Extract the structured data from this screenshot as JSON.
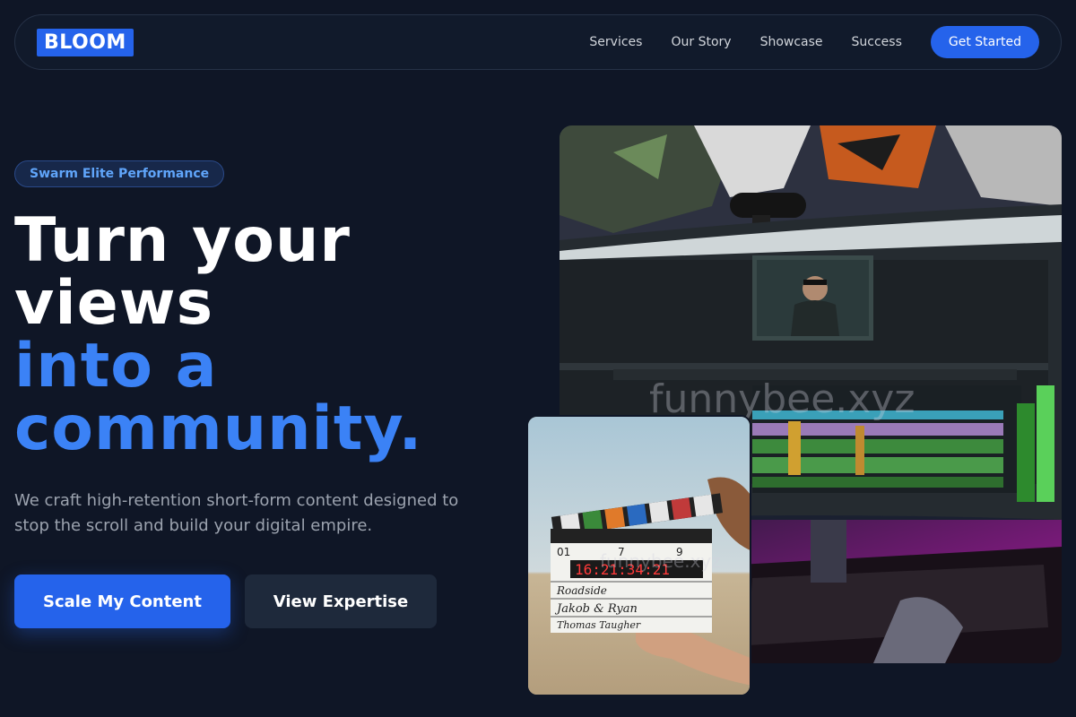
{
  "nav": {
    "logo": "BLOOM",
    "links": [
      "Services",
      "Our Story",
      "Showcase",
      "Success"
    ],
    "cta": "Get Started"
  },
  "hero": {
    "badge": "Swarm Elite Performance",
    "headline": {
      "line1": "Turn your",
      "line2": "views",
      "line3": "into a",
      "line4": "community."
    },
    "subtitle": "We craft high-retention short-form content designed to stop the scroll and build your digital empire.",
    "primary_button": "Scale My Content",
    "secondary_button": "View Expertise"
  },
  "images": {
    "main_watermark": "funnybee.xyz",
    "small_watermark": "funnybee.xyz",
    "clapper": {
      "roll": "01",
      "scene": "7",
      "take": "9",
      "timecode": "16:21:34:21",
      "production": "Roadside",
      "director": "Jakob & Ryan",
      "camera": "Thomas Taugher"
    }
  },
  "colors": {
    "background": "#0f1626",
    "accent": "#2563eb",
    "accent_text": "#3b82f6"
  }
}
